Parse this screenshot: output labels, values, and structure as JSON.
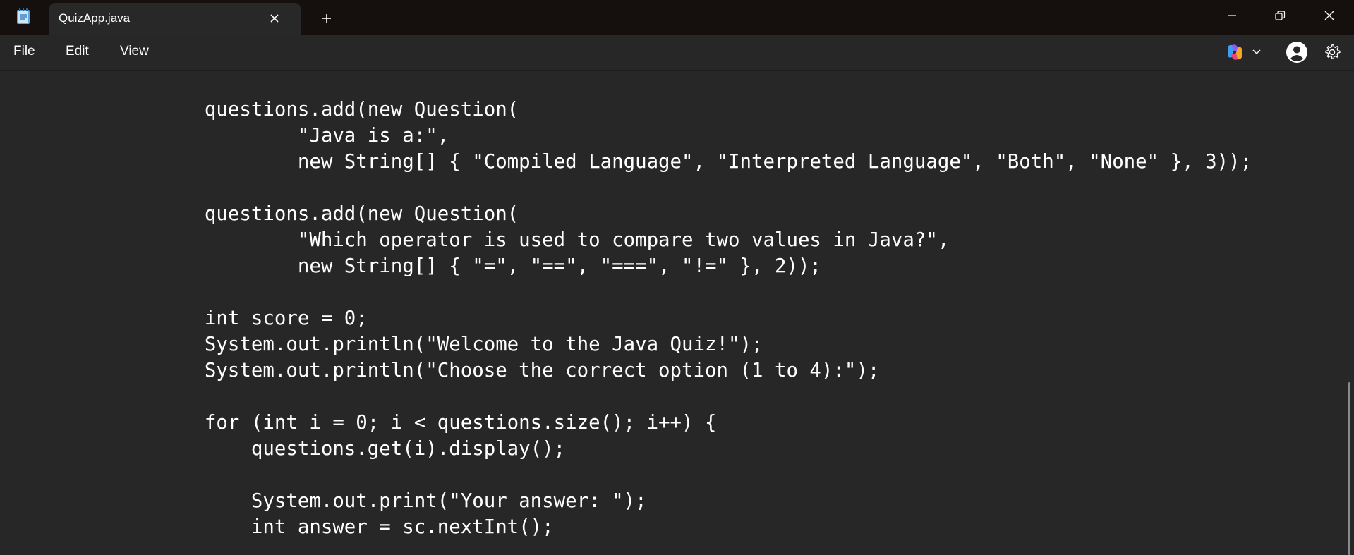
{
  "window": {
    "tab_title": "QuizApp.java"
  },
  "menu": {
    "file": "File",
    "edit": "Edit",
    "view": "View"
  },
  "icons": {
    "app": "notepad-icon",
    "tab_close": "close-icon",
    "new_tab": "plus-icon",
    "minimize": "minimize-icon",
    "maximize": "restore-icon",
    "close": "close-icon",
    "copilot": "copilot-icon",
    "copilot_dropdown": "chevron-down-icon",
    "account": "account-icon",
    "settings": "gear-icon"
  },
  "colors": {
    "titlebar": "#150f0e",
    "editor_bg": "#272727",
    "text": "#ffffff"
  },
  "code_lines": [
    "        questions.add(new Question(",
    "                \"Java is a:\",",
    "                new String[] { \"Compiled Language\", \"Interpreted Language\", \"Both\", \"None\" }, 3));",
    "",
    "        questions.add(new Question(",
    "                \"Which operator is used to compare two values in Java?\",",
    "                new String[] { \"=\", \"==\", \"===\", \"!=\" }, 2));",
    "",
    "        int score = 0;",
    "        System.out.println(\"Welcome to the Java Quiz!\");",
    "        System.out.println(\"Choose the correct option (1 to 4):\");",
    "",
    "        for (int i = 0; i < questions.size(); i++) {",
    "            questions.get(i).display();",
    "",
    "            System.out.print(\"Your answer: \");",
    "            int answer = sc.nextInt();"
  ]
}
